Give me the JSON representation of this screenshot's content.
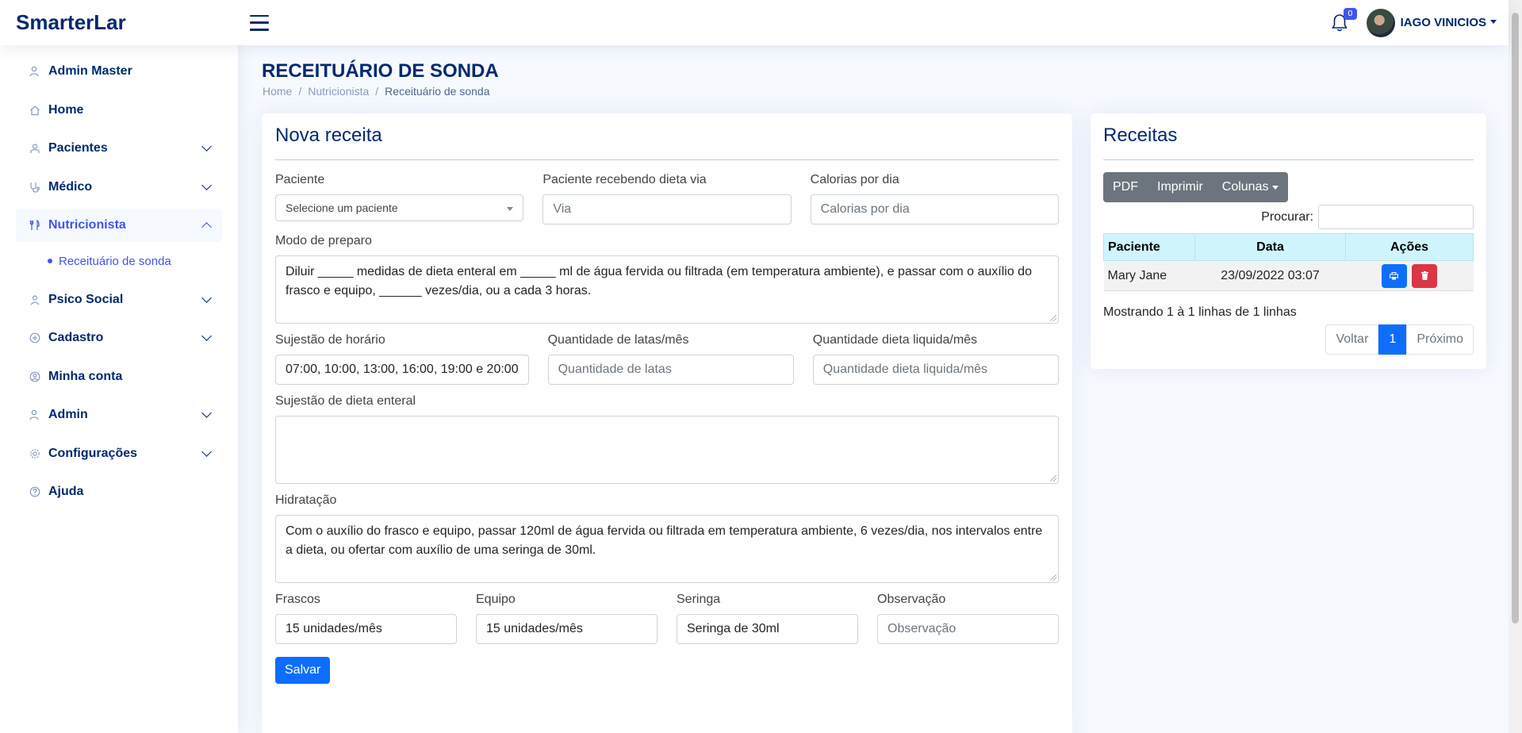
{
  "app": {
    "logo": "SmarterLar"
  },
  "header": {
    "notifications_count": "0",
    "user_name": "IAGO VINICIOS"
  },
  "sidebar": {
    "items": [
      {
        "label": "Admin Master",
        "icon": "person-gear-icon"
      },
      {
        "label": "Home",
        "icon": "house-icon"
      },
      {
        "label": "Pacientes",
        "icon": "person-badge-icon"
      },
      {
        "label": "Médico",
        "icon": "stethoscope-icon"
      },
      {
        "label": "Nutricionista",
        "icon": "fork-knife-icon"
      },
      {
        "label": "Psico Social",
        "icon": "person-lines-icon"
      },
      {
        "label": "Cadastro",
        "icon": "plus-circle-icon"
      },
      {
        "label": "Minha conta",
        "icon": "person-circle-icon"
      },
      {
        "label": "Admin",
        "icon": "person-gear-icon"
      },
      {
        "label": "Configurações",
        "icon": "gear-icon"
      },
      {
        "label": "Ajuda",
        "icon": "question-circle-icon"
      }
    ],
    "sub_item": "Receituário de sonda"
  },
  "page": {
    "title": "RECEITUÁRIO DE SONDA",
    "breadcrumb": [
      "Home",
      "Nutricionista",
      "Receituário de sonda"
    ]
  },
  "form": {
    "title": "Nova receita",
    "paciente": {
      "label": "Paciente",
      "placeholder": "Selecione um paciente"
    },
    "dieta_via": {
      "label": "Paciente recebendo dieta via",
      "placeholder": "Via"
    },
    "calorias": {
      "label": "Calorias por dia",
      "placeholder": "Calorias por dia"
    },
    "modo_preparo": {
      "label": "Modo de preparo",
      "value": "Diluir _____ medidas de dieta enteral em _____ ml de água fervida ou filtrada (em temperatura ambiente), e passar com o auxílio do frasco e equipo, ______ vezes/dia, ou a cada 3 horas."
    },
    "horario": {
      "label": "Sujestão de horário",
      "value": "07:00, 10:00, 13:00, 16:00, 19:00 e 20:00"
    },
    "latas": {
      "label": "Quantidade de latas/mês",
      "placeholder": "Quantidade de latas"
    },
    "dieta_liquida": {
      "label": "Quantidade dieta liquida/mês",
      "placeholder": "Quantidade dieta liquida/mês"
    },
    "dieta_enteral": {
      "label": "Sujestão de dieta enteral",
      "value": ""
    },
    "hidratacao": {
      "label": "Hidratação",
      "value": "Com o auxílio do frasco e equipo, passar 120ml de água fervida ou filtrada em temperatura ambiente, 6 vezes/dia, nos intervalos entre a dieta, ou ofertar com auxílio de uma seringa de 30ml."
    },
    "frascos": {
      "label": "Frascos",
      "value": "15 unidades/mês"
    },
    "equipo": {
      "label": "Equipo",
      "value": "15 unidades/mês"
    },
    "seringa": {
      "label": "Seringa",
      "value": "Seringa de 30ml"
    },
    "observacao": {
      "label": "Observação",
      "placeholder": "Observação"
    },
    "save_label": "Salvar"
  },
  "receitas": {
    "title": "Receitas",
    "buttons": {
      "pdf": "PDF",
      "print": "Imprimir",
      "columns": "Colunas"
    },
    "search_label": "Procurar:",
    "columns": [
      "Paciente",
      "Data",
      "Ações"
    ],
    "rows": [
      {
        "paciente": "Mary Jane",
        "data": "23/09/2022 03:07"
      }
    ],
    "info": "Mostrando 1 à 1 linhas de 1 linhas",
    "pager": {
      "prev": "Voltar",
      "current": "1",
      "next": "Próximo"
    }
  }
}
